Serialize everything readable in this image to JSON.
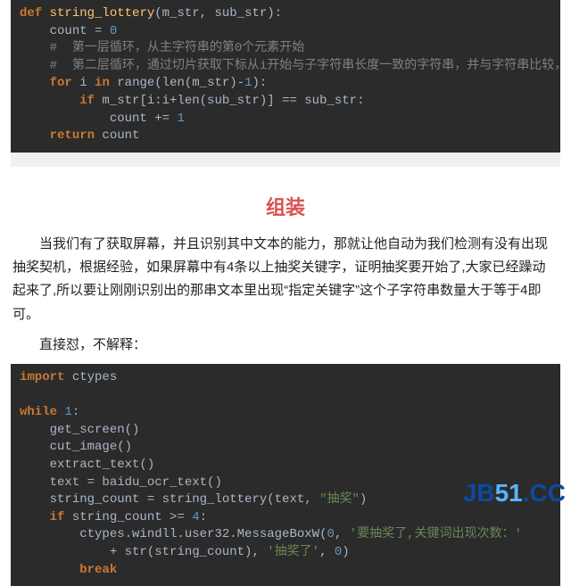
{
  "code1": {
    "l1": {
      "def": "def",
      "name": "string_lottery",
      "params": "(m_str, sub_str):"
    },
    "l2": {
      "a": "count = ",
      "n0": "0"
    },
    "l3": {
      "c": "#  第一层循环，从主字符串的第0个元素开始"
    },
    "l4": {
      "c": "#  第二层循环，通过切片获取下标从i开始与子字符串长度一致的字符串，并与字符串比较，如果等"
    },
    "l5": {
      "for": "for",
      "a": " i ",
      "in": "in",
      "b": " range(len(m_str)-",
      "n1": "1",
      "c": "):"
    },
    "l6": {
      "if": "if",
      "a": " m_str[i:i+len(sub_str)] == sub_str:"
    },
    "l7": {
      "a": "count += ",
      "n1": "1"
    },
    "l8": {
      "ret": "return",
      "a": " count"
    }
  },
  "heading": "组装",
  "para1": "当我们有了获取屏幕，并且识别其中文本的能力，那就让他自动为我们检测有没有出现抽奖契机，根据经验，如果屏幕中有4条以上抽奖关键字，证明抽奖要开始了,大家已经躁动起来了,所以要让刚刚识别出的那串文本里出现“指定关键字”这个子字符串数量大于等于4即可。",
  "para2": "直接怼，不解释：",
  "code2": {
    "l1": {
      "imp": "import",
      "a": " ctypes"
    },
    "l3": {
      "wh": "while",
      "sp": " ",
      "n1": "1",
      "col": ":"
    },
    "l4": {
      "a": "get_screen()"
    },
    "l5": {
      "a": "cut_image()"
    },
    "l6": {
      "a": "extract_text()"
    },
    "l7": {
      "a": "text = baidu_ocr_text()"
    },
    "l8": {
      "a": "string_count = string_lottery(text, ",
      "s": "\"抽奖\"",
      "b": ")"
    },
    "l9": {
      "if": "if",
      "a": " string_count >= ",
      "n4": "4",
      "col": ":"
    },
    "l10": {
      "a": "ctypes.windll.user32.MessageBoxW(",
      "n0": "0",
      "b": ", ",
      "s": "'要抽奖了,关键词出现次数：'"
    },
    "l11": {
      "a": "+ str(string_count), ",
      "s": "'抽奖了'",
      "b": ", ",
      "n0": "0",
      "c": ")"
    },
    "l12": {
      "br": "break"
    }
  },
  "watermark": {
    "jb": "JB",
    "n51": "51",
    "cc": ".CC"
  }
}
